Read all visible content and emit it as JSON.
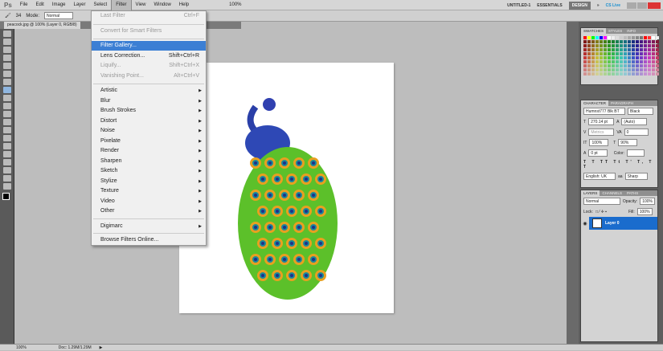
{
  "app": {
    "logo": "Ps",
    "menus": [
      "File",
      "Edit",
      "Image",
      "Layer",
      "Select",
      "Filter",
      "View",
      "Window",
      "Help"
    ],
    "open_menu": "Filter",
    "zoom": "100%"
  },
  "workspace": {
    "items": [
      "UNTITLED-1",
      "ESSENTIALS",
      "DESIGN"
    ],
    "active": "DESIGN",
    "more": "»",
    "cslive": "CS Live"
  },
  "options": {
    "brush_size": "34",
    "mode_label": "Mode:",
    "mode_value": "Normal"
  },
  "document": {
    "tab_title": "peacock.jpg @ 100% (Layer 0, RGB/8)"
  },
  "filter_menu": {
    "last_filter": {
      "label": "Last Filter",
      "shortcut": "Ctrl+F"
    },
    "convert": "Convert for Smart Filters",
    "gallery": "Filter Gallery...",
    "lens": {
      "label": "Lens Correction...",
      "shortcut": "Shift+Ctrl+R"
    },
    "liquify": {
      "label": "Liquify...",
      "shortcut": "Shift+Ctrl+X"
    },
    "vanishing": {
      "label": "Vanishing Point...",
      "shortcut": "Alt+Ctrl+V"
    },
    "submenus": [
      "Artistic",
      "Blur",
      "Brush Strokes",
      "Distort",
      "Noise",
      "Pixelate",
      "Render",
      "Sharpen",
      "Sketch",
      "Stylize",
      "Texture",
      "Video",
      "Other"
    ],
    "digimarc": "Digimarc",
    "browse": "Browse Filters Online..."
  },
  "swatches_panel": {
    "tabs": [
      "SWATCHES",
      "STYLES",
      "INFO"
    ]
  },
  "character_panel": {
    "tabs": [
      "CHARACTER",
      "PARAGRAPH"
    ],
    "font": "Humnst777 Blk BT",
    "style": "Black",
    "size": "270.14 pt",
    "leading": "(Auto)",
    "kerning": "Metrics",
    "tracking": "0",
    "vscale": "100%",
    "hscale": "90%",
    "baseline": "0 pt",
    "color_label": "Color:",
    "language": "English: UK",
    "aa": "Sharp"
  },
  "layers_panel": {
    "tabs": [
      "LAYERS",
      "CHANNELS",
      "PATHS"
    ],
    "blend": "Normal",
    "opacity_label": "Opacity:",
    "opacity": "100%",
    "lock_label": "Lock:",
    "fill_label": "Fill:",
    "fill": "100%",
    "layer_name": "Layer 0"
  },
  "status": {
    "zoom": "100%",
    "doc": "Doc: 1.29M/1.29M"
  },
  "colors": {
    "highlight": "#3c7fd4",
    "layer_selected": "#1a6ccd"
  }
}
